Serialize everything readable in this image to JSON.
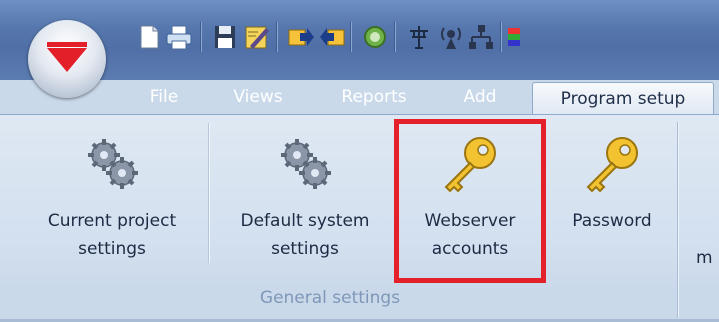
{
  "window": {
    "title": ""
  },
  "quick_access": {
    "icons": [
      "new-document-icon",
      "print-icon",
      "save-icon",
      "edit-icon",
      "export-icon",
      "import-icon",
      "refresh-gear-icon",
      "antenna-icon",
      "wireless-icon",
      "network-icon",
      "color-palette-icon"
    ]
  },
  "tabs": [
    {
      "label": "File"
    },
    {
      "label": "Views"
    },
    {
      "label": "Reports"
    },
    {
      "label": "Add"
    },
    {
      "label": "Program setup"
    }
  ],
  "ribbon": {
    "buttons": [
      {
        "label_line1": "Current project",
        "label_line2": "settings",
        "icon": "gears-icon"
      },
      {
        "label_line1": "Default system",
        "label_line2": "settings",
        "icon": "gears-icon"
      },
      {
        "label_line1": "Webserver",
        "label_line2": "accounts",
        "icon": "key-icon"
      },
      {
        "label_line1": "Password",
        "label_line2": "",
        "icon": "key-icon"
      }
    ],
    "partial_label": "m",
    "group_label": "General settings"
  },
  "colors": {
    "highlight": "#e4202a",
    "brand_red": "#e3202a",
    "tab_bar": "#5677ad"
  }
}
